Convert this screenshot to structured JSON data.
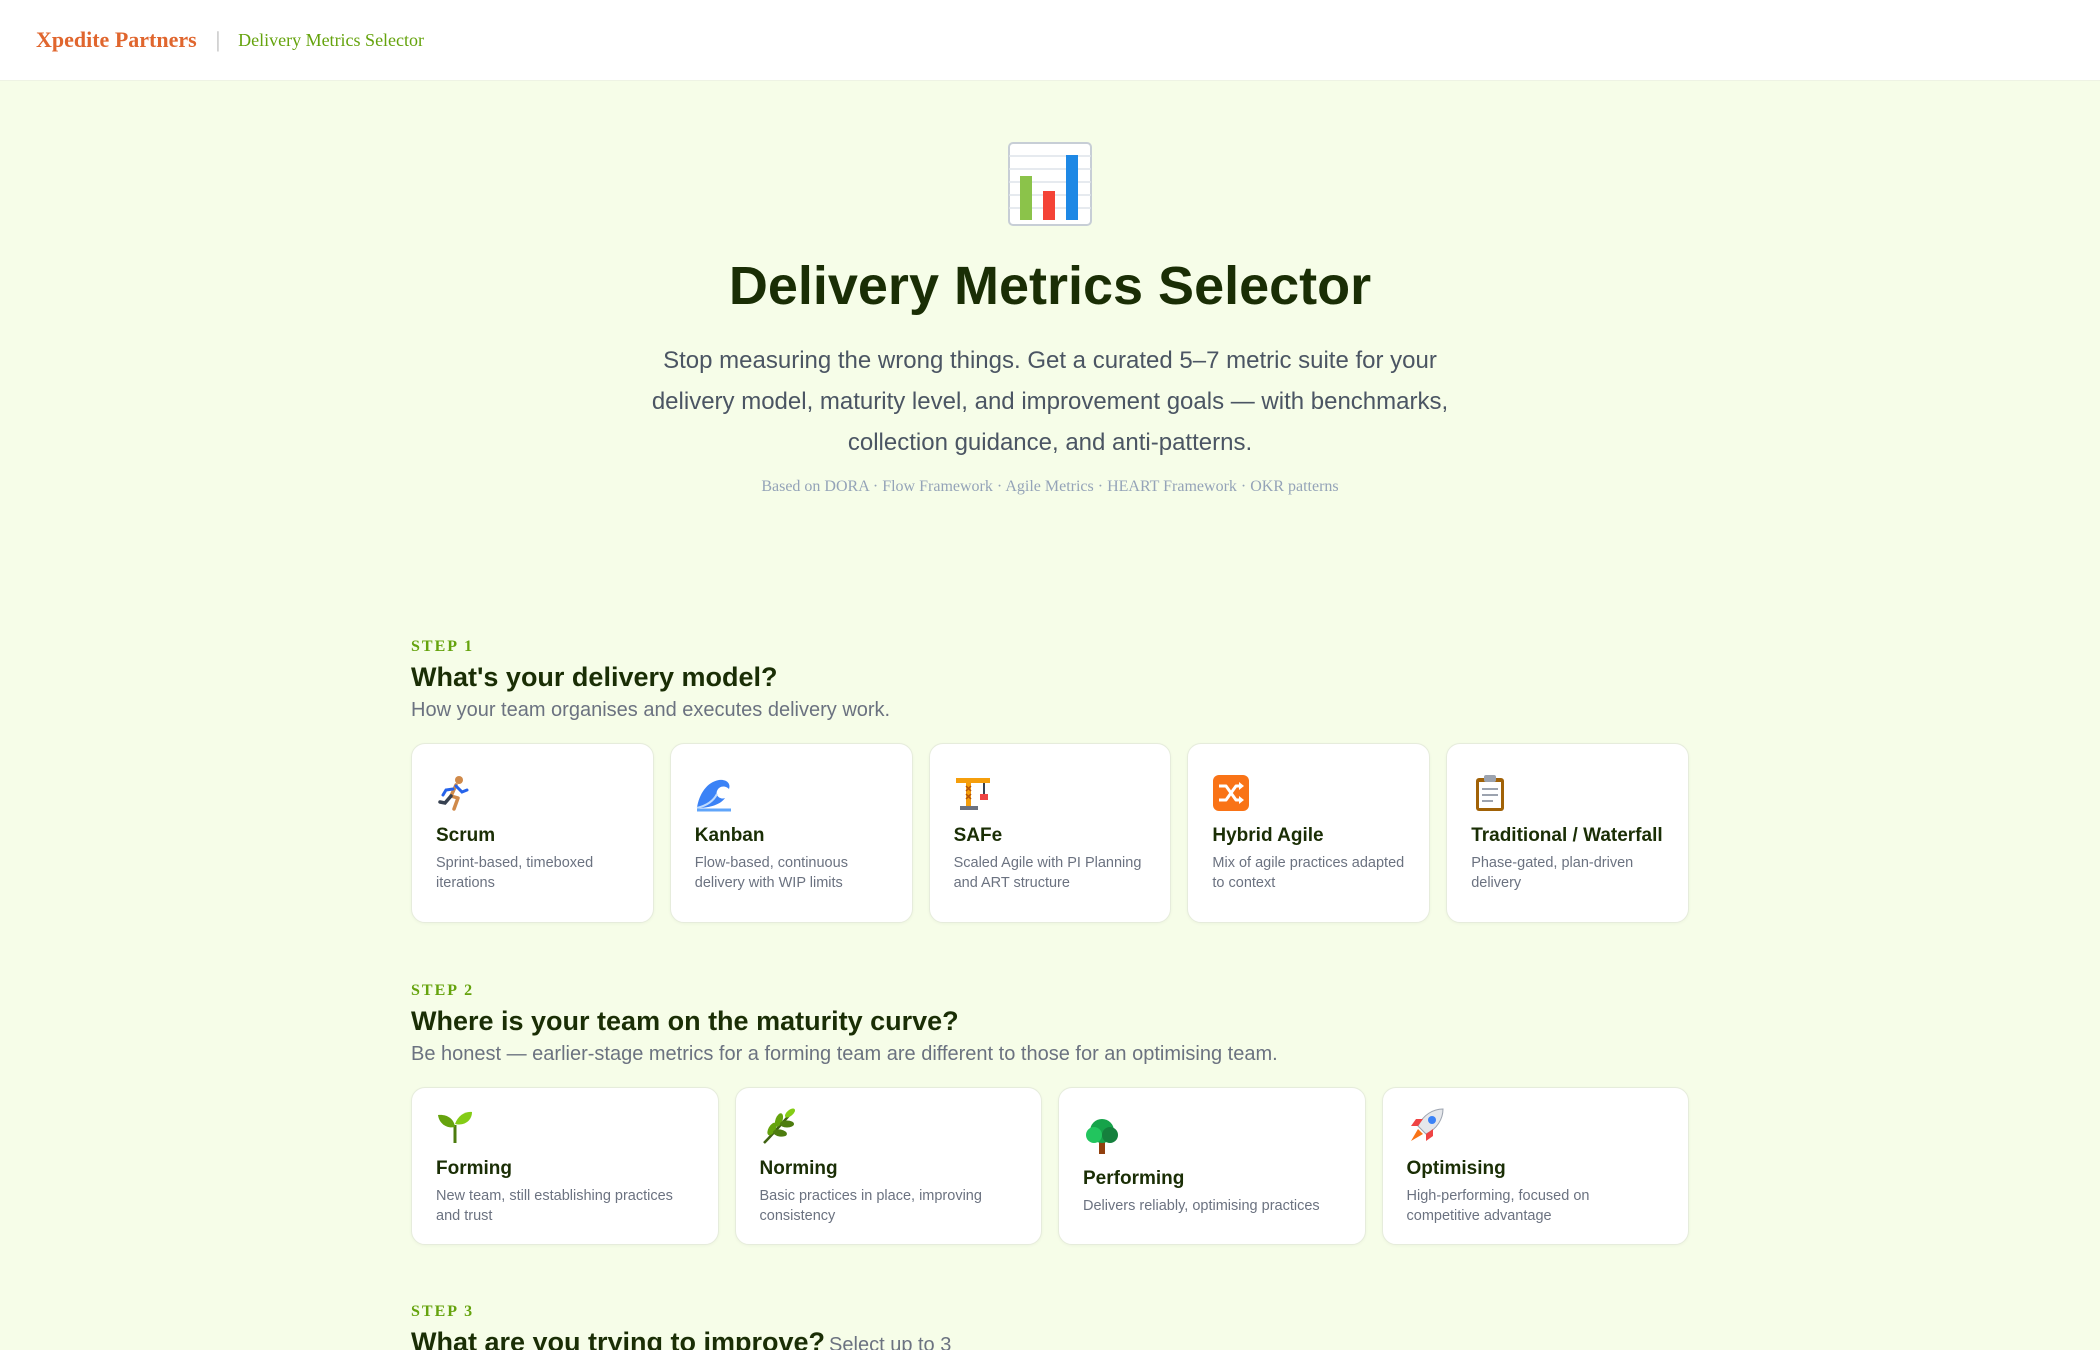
{
  "header": {
    "brand": "Xpedite Partners",
    "separator": "|",
    "tool_name": "Delivery Metrics Selector"
  },
  "hero": {
    "icon": "bar-chart-icon",
    "title": "Delivery Metrics Selector",
    "subtitle": "Stop measuring the wrong things. Get a curated 5–7 metric suite for your delivery model, maturity level, and improvement goals — with benchmarks, collection guidance, and anti-patterns.",
    "based_on": "Based on DORA · Flow Framework · Agile Metrics · HEART Framework · OKR patterns"
  },
  "step1": {
    "label": "STEP 1",
    "title": "What's your delivery model?",
    "description": "How your team organises and executes delivery work.",
    "options": [
      {
        "icon": "runner-icon",
        "title": "Scrum",
        "description": "Sprint-based, timeboxed iterations"
      },
      {
        "icon": "wave-icon",
        "title": "Kanban",
        "description": "Flow-based, continuous delivery with WIP limits"
      },
      {
        "icon": "crane-icon",
        "title": "SAFe",
        "description": "Scaled Agile with PI Planning and ART structure"
      },
      {
        "icon": "shuffle-icon",
        "title": "Hybrid Agile",
        "description": "Mix of agile practices adapted to context"
      },
      {
        "icon": "clipboard-icon",
        "title": "Traditional / Waterfall",
        "description": "Phase-gated, plan-driven delivery"
      }
    ]
  },
  "step2": {
    "label": "STEP 2",
    "title": "Where is your team on the maturity curve?",
    "description": "Be honest — earlier-stage metrics for a forming team are different to those for an optimising team.",
    "options": [
      {
        "icon": "seedling-icon",
        "title": "Forming",
        "description": "New team, still establishing practices and trust"
      },
      {
        "icon": "herb-icon",
        "title": "Norming",
        "description": "Basic practices in place, improving consistency"
      },
      {
        "icon": "tree-icon",
        "title": "Performing",
        "description": "Delivers reliably, optimising practices"
      },
      {
        "icon": "rocket-icon",
        "title": "Optimising",
        "description": "High-performing, focused on competitive advantage"
      }
    ]
  },
  "step3": {
    "label": "STEP 3",
    "title": "What are you trying to improve?",
    "hint": "Select up to 3"
  },
  "colors": {
    "background": "#f6fde8",
    "brand": "#e0662e",
    "accent": "#65a30d",
    "heading": "#1a2e05"
  }
}
